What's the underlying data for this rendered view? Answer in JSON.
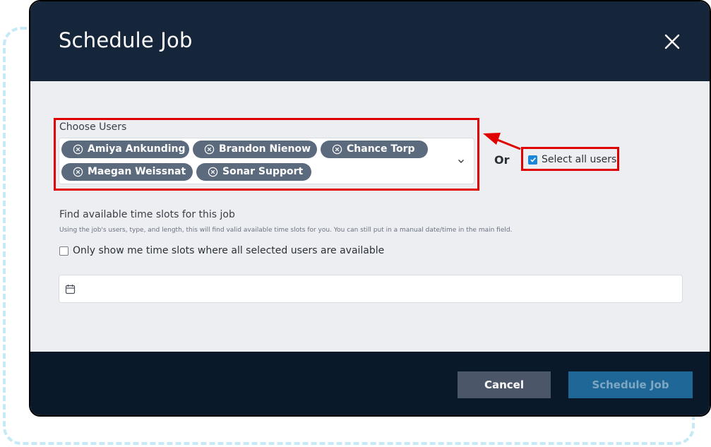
{
  "modal": {
    "title": "Schedule Job"
  },
  "users": {
    "label": "Choose Users",
    "selected": [
      "Amiya Ankunding",
      "Brandon Nienow",
      "Chance Torp",
      "Maegan Weissnat",
      "Sonar Support"
    ]
  },
  "or_label": "Or",
  "select_all": {
    "label": "Select all users",
    "checked": true
  },
  "time_slots": {
    "title": "Find available time slots for this job",
    "help": "Using the job's users, type, and length, this will find valid available time slots for you. You can still put in a manual date/time in the main field.",
    "only_show_label": "Only show me time slots where all selected users are available",
    "only_show_checked": false,
    "date_value": ""
  },
  "footer": {
    "cancel_label": "Cancel",
    "schedule_label": "Schedule Job"
  },
  "colors": {
    "header_bg": "#16263a",
    "body_bg": "#eceef2",
    "footer_bg": "#0a1929",
    "chip_bg": "#5b6a7c",
    "annotation": "#e00000",
    "checkbox_accent": "#1c86d8",
    "schedule_button": "#1e6797",
    "cancel_button": "#4c5669"
  },
  "icons": {
    "close": "close-icon",
    "chip_remove": "circle-x-icon",
    "dropdown": "chevron-down-icon",
    "calendar": "calendar-icon",
    "checkmark": "check-icon"
  }
}
